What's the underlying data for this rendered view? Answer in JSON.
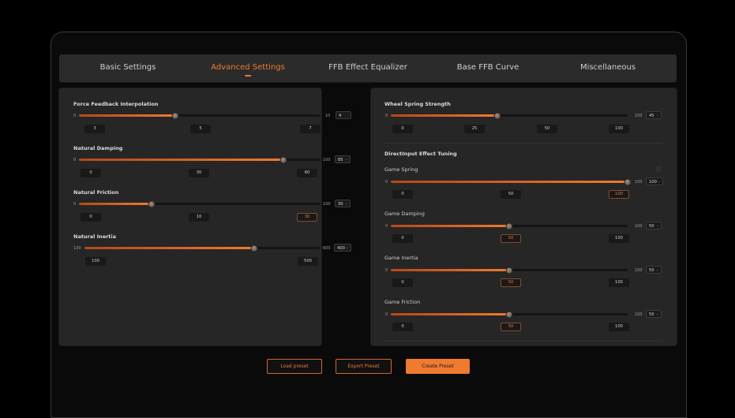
{
  "tabs": [
    "Basic Settings",
    "Advanced Settings",
    "FFB Effect Equalizer",
    "Base FFB Curve",
    "Miscellaneous"
  ],
  "active_tab": "Advanced Settings",
  "left": {
    "interpolation": {
      "title": "Force Feedback Interpolation",
      "min": "0",
      "max": "10",
      "value": "4",
      "level": 0.4,
      "ticks": [
        "3",
        "5",
        "7"
      ]
    },
    "damping": {
      "title": "Natural Damping",
      "min": "0",
      "max": "100",
      "value": "85",
      "level": 0.85,
      "ticks": [
        "0",
        "30",
        "60"
      ]
    },
    "friction": {
      "title": "Natural Friction",
      "min": "0",
      "max": "100",
      "value": "30",
      "level": 0.3,
      "ticks": [
        "0",
        "10",
        "30"
      ]
    },
    "inertia": {
      "title": "Natural Inertia",
      "min": "100",
      "max": "600",
      "value": "400",
      "level": 0.72,
      "ticks": [
        "100",
        "500"
      ]
    }
  },
  "right": {
    "wheel_spring": {
      "title": "Wheel Spring Strength",
      "min": "0",
      "max": "100",
      "value": "45",
      "level": 0.45,
      "ticks": [
        "0",
        "25",
        "50",
        "100"
      ]
    },
    "section_title": "DirectInput Effect Tuning",
    "game_spring": {
      "title": "Game Spring",
      "min": "0",
      "max": "100",
      "value": "100",
      "level": 1.0,
      "ticks": [
        "0",
        "50",
        "100"
      ]
    },
    "game_damping": {
      "title": "Game Damping",
      "min": "0",
      "max": "100",
      "value": "50",
      "level": 0.5,
      "ticks": [
        "0",
        "50",
        "100"
      ]
    },
    "game_inertia": {
      "title": "Game Inertia",
      "min": "0",
      "max": "100",
      "value": "50",
      "level": 0.5,
      "ticks": [
        "0",
        "50",
        "100"
      ]
    },
    "game_friction": {
      "title": "Game Friction",
      "min": "0",
      "max": "100",
      "value": "50",
      "level": 0.5,
      "ticks": [
        "0",
        "50",
        "100"
      ]
    }
  },
  "buttons": {
    "load": "Load preset",
    "export": "Export Preset",
    "create": "Create Preset"
  },
  "colors": {
    "accent": "#f07a2e",
    "panel": "#262626",
    "background": "#000000"
  }
}
